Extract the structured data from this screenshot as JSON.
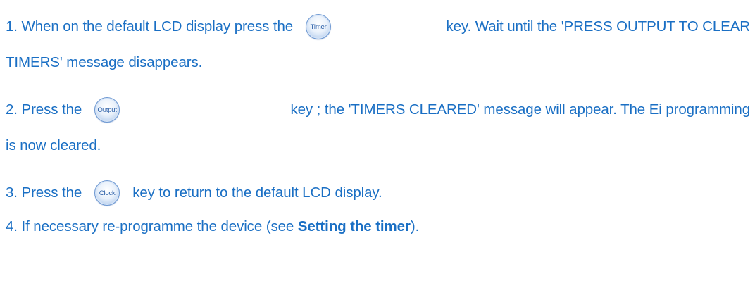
{
  "steps": [
    {
      "before": "1. When on the default LCD display press the",
      "key": "Timer",
      "after": "key. Wait until the 'PRESS OUTPUT TO CLEAR",
      "continuation": "TIMERS' message disappears."
    },
    {
      "before": "2. Press the",
      "key": "Output",
      "after": "key ; the 'TIMERS CLEARED' message will appear. The Ei programming",
      "continuation": "is now cleared."
    },
    {
      "before": "3. Press the",
      "key": "Clock",
      "after": "key to return to the default LCD display."
    },
    {
      "before": "4. If necessary re-programme the device (see ",
      "link": "Setting the timer",
      "after": ")."
    }
  ],
  "colors": {
    "text": "#1a6fc4",
    "key_border": "#6d98d2",
    "key_label": "#2b5fa8"
  }
}
